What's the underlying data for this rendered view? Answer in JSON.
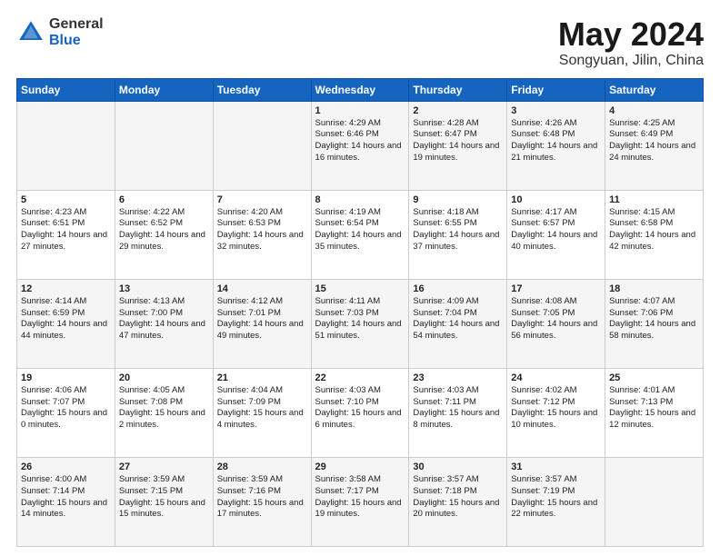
{
  "header": {
    "logo_general": "General",
    "logo_blue": "Blue",
    "title": "May 2024",
    "location": "Songyuan, Jilin, China"
  },
  "weekdays": [
    "Sunday",
    "Monday",
    "Tuesday",
    "Wednesday",
    "Thursday",
    "Friday",
    "Saturday"
  ],
  "weeks": [
    [
      {
        "day": "",
        "info": ""
      },
      {
        "day": "",
        "info": ""
      },
      {
        "day": "",
        "info": ""
      },
      {
        "day": "1",
        "info": "Sunrise: 4:29 AM\nSunset: 6:46 PM\nDaylight: 14 hours\nand 16 minutes."
      },
      {
        "day": "2",
        "info": "Sunrise: 4:28 AM\nSunset: 6:47 PM\nDaylight: 14 hours\nand 19 minutes."
      },
      {
        "day": "3",
        "info": "Sunrise: 4:26 AM\nSunset: 6:48 PM\nDaylight: 14 hours\nand 21 minutes."
      },
      {
        "day": "4",
        "info": "Sunrise: 4:25 AM\nSunset: 6:49 PM\nDaylight: 14 hours\nand 24 minutes."
      }
    ],
    [
      {
        "day": "5",
        "info": "Sunrise: 4:23 AM\nSunset: 6:51 PM\nDaylight: 14 hours\nand 27 minutes."
      },
      {
        "day": "6",
        "info": "Sunrise: 4:22 AM\nSunset: 6:52 PM\nDaylight: 14 hours\nand 29 minutes."
      },
      {
        "day": "7",
        "info": "Sunrise: 4:20 AM\nSunset: 6:53 PM\nDaylight: 14 hours\nand 32 minutes."
      },
      {
        "day": "8",
        "info": "Sunrise: 4:19 AM\nSunset: 6:54 PM\nDaylight: 14 hours\nand 35 minutes."
      },
      {
        "day": "9",
        "info": "Sunrise: 4:18 AM\nSunset: 6:55 PM\nDaylight: 14 hours\nand 37 minutes."
      },
      {
        "day": "10",
        "info": "Sunrise: 4:17 AM\nSunset: 6:57 PM\nDaylight: 14 hours\nand 40 minutes."
      },
      {
        "day": "11",
        "info": "Sunrise: 4:15 AM\nSunset: 6:58 PM\nDaylight: 14 hours\nand 42 minutes."
      }
    ],
    [
      {
        "day": "12",
        "info": "Sunrise: 4:14 AM\nSunset: 6:59 PM\nDaylight: 14 hours\nand 44 minutes."
      },
      {
        "day": "13",
        "info": "Sunrise: 4:13 AM\nSunset: 7:00 PM\nDaylight: 14 hours\nand 47 minutes."
      },
      {
        "day": "14",
        "info": "Sunrise: 4:12 AM\nSunset: 7:01 PM\nDaylight: 14 hours\nand 49 minutes."
      },
      {
        "day": "15",
        "info": "Sunrise: 4:11 AM\nSunset: 7:03 PM\nDaylight: 14 hours\nand 51 minutes."
      },
      {
        "day": "16",
        "info": "Sunrise: 4:09 AM\nSunset: 7:04 PM\nDaylight: 14 hours\nand 54 minutes."
      },
      {
        "day": "17",
        "info": "Sunrise: 4:08 AM\nSunset: 7:05 PM\nDaylight: 14 hours\nand 56 minutes."
      },
      {
        "day": "18",
        "info": "Sunrise: 4:07 AM\nSunset: 7:06 PM\nDaylight: 14 hours\nand 58 minutes."
      }
    ],
    [
      {
        "day": "19",
        "info": "Sunrise: 4:06 AM\nSunset: 7:07 PM\nDaylight: 15 hours\nand 0 minutes."
      },
      {
        "day": "20",
        "info": "Sunrise: 4:05 AM\nSunset: 7:08 PM\nDaylight: 15 hours\nand 2 minutes."
      },
      {
        "day": "21",
        "info": "Sunrise: 4:04 AM\nSunset: 7:09 PM\nDaylight: 15 hours\nand 4 minutes."
      },
      {
        "day": "22",
        "info": "Sunrise: 4:03 AM\nSunset: 7:10 PM\nDaylight: 15 hours\nand 6 minutes."
      },
      {
        "day": "23",
        "info": "Sunrise: 4:03 AM\nSunset: 7:11 PM\nDaylight: 15 hours\nand 8 minutes."
      },
      {
        "day": "24",
        "info": "Sunrise: 4:02 AM\nSunset: 7:12 PM\nDaylight: 15 hours\nand 10 minutes."
      },
      {
        "day": "25",
        "info": "Sunrise: 4:01 AM\nSunset: 7:13 PM\nDaylight: 15 hours\nand 12 minutes."
      }
    ],
    [
      {
        "day": "26",
        "info": "Sunrise: 4:00 AM\nSunset: 7:14 PM\nDaylight: 15 hours\nand 14 minutes."
      },
      {
        "day": "27",
        "info": "Sunrise: 3:59 AM\nSunset: 7:15 PM\nDaylight: 15 hours\nand 15 minutes."
      },
      {
        "day": "28",
        "info": "Sunrise: 3:59 AM\nSunset: 7:16 PM\nDaylight: 15 hours\nand 17 minutes."
      },
      {
        "day": "29",
        "info": "Sunrise: 3:58 AM\nSunset: 7:17 PM\nDaylight: 15 hours\nand 19 minutes."
      },
      {
        "day": "30",
        "info": "Sunrise: 3:57 AM\nSunset: 7:18 PM\nDaylight: 15 hours\nand 20 minutes."
      },
      {
        "day": "31",
        "info": "Sunrise: 3:57 AM\nSunset: 7:19 PM\nDaylight: 15 hours\nand 22 minutes."
      },
      {
        "day": "",
        "info": ""
      }
    ]
  ]
}
